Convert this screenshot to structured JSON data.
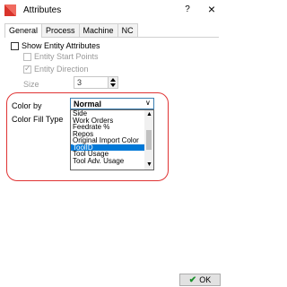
{
  "window": {
    "title": "Attributes",
    "help": "?",
    "close": "×"
  },
  "tabs": [
    "General",
    "Process",
    "Machine",
    "NC"
  ],
  "active_tab": "General",
  "options": {
    "show_entity_attributes": {
      "label": "Show Entity Attributes",
      "checked": false
    },
    "entity_start_points": {
      "label": "Entity Start Points",
      "checked": false,
      "disabled": true
    },
    "entity_direction": {
      "label": "Entity Direction",
      "checked": true,
      "disabled": true
    },
    "size": {
      "label": "Size",
      "value": "3"
    }
  },
  "color_by": {
    "label": "Color by",
    "selected": "Normal",
    "fill_label": "Color Fill Type",
    "items": [
      "Side",
      "Work Orders",
      "Feedrate %",
      "Repos",
      "Original Import Color",
      "ToolID",
      "Tool Usage",
      "Tool Adv. Usage"
    ],
    "highlighted": "ToolID"
  },
  "footer": {
    "ok_label": "OK"
  },
  "colors": {
    "highlight": "#0078d7",
    "callout": "#e03333",
    "ok_check": "#1b8f2b"
  }
}
